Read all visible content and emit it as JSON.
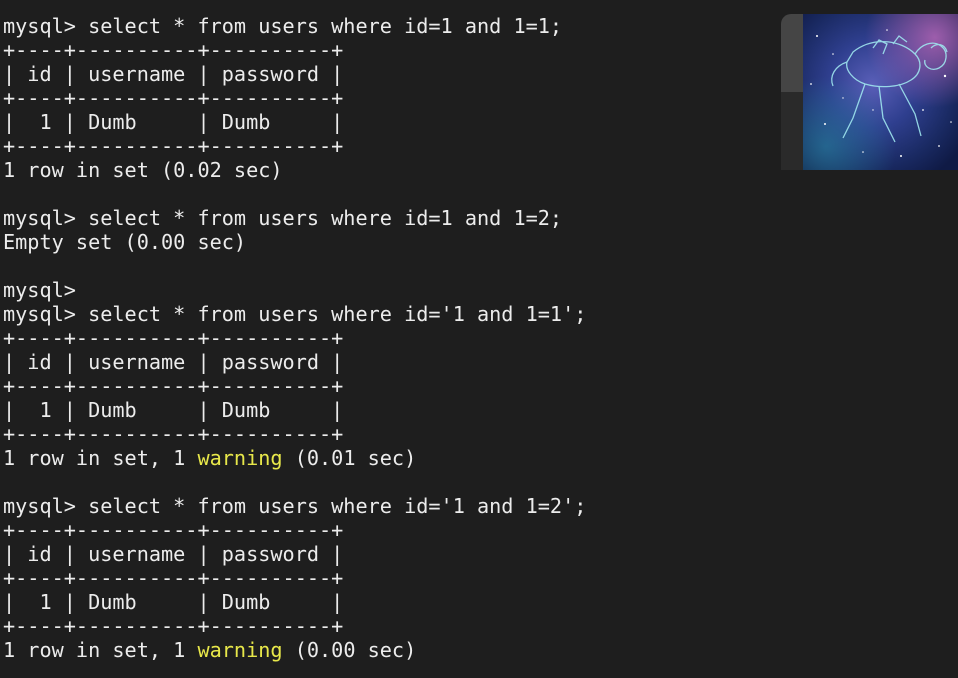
{
  "terminal": {
    "lines": [
      {
        "text": "mysql> select * from users where id=1 and 1=1;"
      },
      {
        "text": "+----+----------+----------+"
      },
      {
        "text": "| id | username | password |"
      },
      {
        "text": "+----+----------+----------+"
      },
      {
        "text": "|  1 | Dumb     | Dumb     |"
      },
      {
        "text": "+----+----------+----------+"
      },
      {
        "text": "1 row in set (0.02 sec)"
      },
      {
        "text": ""
      },
      {
        "text": "mysql> select * from users where id=1 and 1=2;"
      },
      {
        "text": "Empty set (0.00 sec)"
      },
      {
        "text": ""
      },
      {
        "text": "mysql>"
      },
      {
        "text": "mysql> select * from users where id='1 and 1=1';"
      },
      {
        "text": "+----+----------+----------+"
      },
      {
        "text": "| id | username | password |"
      },
      {
        "text": "+----+----------+----------+"
      },
      {
        "text": "|  1 | Dumb     | Dumb     |"
      },
      {
        "text": "+----+----------+----------+"
      },
      {
        "pre": "1 row in set, 1 ",
        "warn": "warning",
        "post": " (0.01 sec)"
      },
      {
        "text": ""
      },
      {
        "text": "mysql> select * from users where id='1 and 1=2';"
      },
      {
        "text": "+----+----------+----------+"
      },
      {
        "text": "| id | username | password |"
      },
      {
        "text": "+----+----------+----------+"
      },
      {
        "text": "|  1 | Dumb     | Dumb     |"
      },
      {
        "text": "+----+----------+----------+"
      },
      {
        "pre": "1 row in set, 1 ",
        "warn": "warning",
        "post": " (0.00 sec)"
      }
    ]
  },
  "colors": {
    "background": "#1e1e1e",
    "foreground": "#ececec",
    "warning": "#e8e84a"
  },
  "background_window": {
    "image": "aries-constellation-wallpaper"
  }
}
